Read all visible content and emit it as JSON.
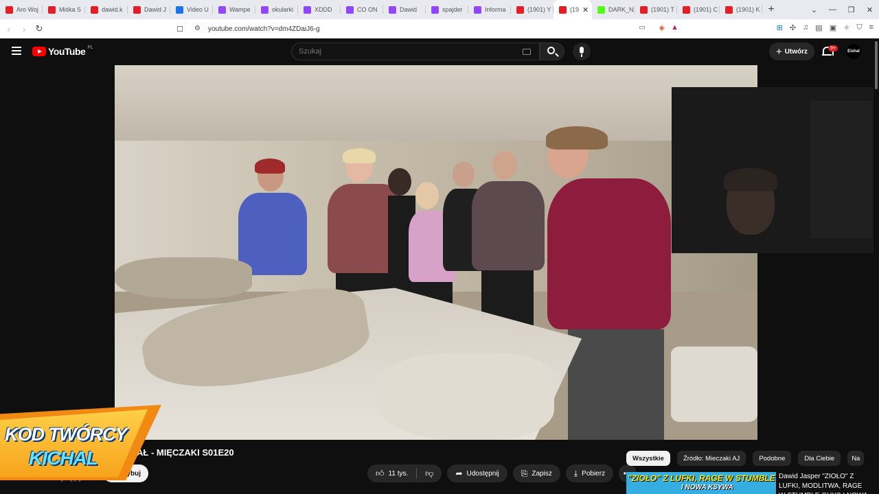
{
  "browser": {
    "tabs": [
      {
        "label": "Aro Woj",
        "icon": "youtube-icon",
        "color": "#e41e24"
      },
      {
        "label": "Miśka S",
        "icon": "youtube-icon",
        "color": "#e41e24"
      },
      {
        "label": "dawid.k",
        "icon": "youtube-icon",
        "color": "#e41e24"
      },
      {
        "label": "Dawid J",
        "icon": "youtube-icon",
        "color": "#e41e24"
      },
      {
        "label": "Video U",
        "icon": "link-icon",
        "color": "#1a73e8"
      },
      {
        "label": "Wampe",
        "icon": "twitch-icon",
        "color": "#9146ff"
      },
      {
        "label": "okularki",
        "icon": "twitch-icon",
        "color": "#9146ff"
      },
      {
        "label": "XDDD",
        "icon": "twitch-icon",
        "color": "#9146ff"
      },
      {
        "label": "CO ON",
        "icon": "twitch-icon",
        "color": "#9146ff"
      },
      {
        "label": "Dawid",
        "icon": "twitch-icon",
        "color": "#9146ff"
      },
      {
        "label": "spajder",
        "icon": "twitch-icon",
        "color": "#9146ff"
      },
      {
        "label": "Informa",
        "icon": "twitch-icon",
        "color": "#9146ff"
      },
      {
        "label": "(1901) Y",
        "icon": "youtube-icon",
        "color": "#e41e24"
      },
      {
        "label": "(19",
        "icon": "youtube-icon",
        "color": "#e41e24",
        "active": true
      },
      {
        "label": "DARK_N",
        "icon": "kick-icon",
        "color": "#53fc18"
      },
      {
        "label": "(1901) T",
        "icon": "youtube-icon",
        "color": "#e41e24"
      },
      {
        "label": "(1901) C",
        "icon": "youtube-icon",
        "color": "#e41e24"
      },
      {
        "label": "(1901) K",
        "icon": "youtube-icon",
        "color": "#e41e24"
      }
    ],
    "url": "youtube.com/watch?v=dm4ZDaiJ6-g"
  },
  "youtube": {
    "logo_text": "YouTube",
    "region": "PL",
    "search_placeholder": "Szukaj",
    "create_label": "Utwórz",
    "notification_count": "9+",
    "avatar_text": "Eishal"
  },
  "video": {
    "title_visible": "CIAŁ - MIĘCZAKI S01E20",
    "channel_sub": "subskrybujących",
    "subscribe_label": "Subskrybuj",
    "likes": "11 tys.",
    "share_label": "Udostępnij",
    "save_label": "Zapisz",
    "download_label": "Pobierz",
    "more_label": "•••"
  },
  "chips": [
    {
      "label": "Wszystkie",
      "active": true
    },
    {
      "label": "Źródło: Mieczaki AJ"
    },
    {
      "label": "Podobne"
    },
    {
      "label": "Dla Ciebie"
    },
    {
      "label": "Na"
    }
  ],
  "recommendation": {
    "thumb_text": "\"ZIOŁO\" Z LUFKI, RAGE W STUMBLE GUYS",
    "thumb_text2": "I NOWA KSYWA",
    "title": "Dawid Jasper \"ZIOŁO\" Z LUFKI, MODLITWA, RAGE W STUMBLE GUYS I NOWA"
  },
  "overlay": {
    "line1": "KOD TWÓRCY",
    "line2": "KICHAL",
    "colors": {
      "orange": "#f18a12",
      "cyan": "#66e3ff"
    }
  }
}
